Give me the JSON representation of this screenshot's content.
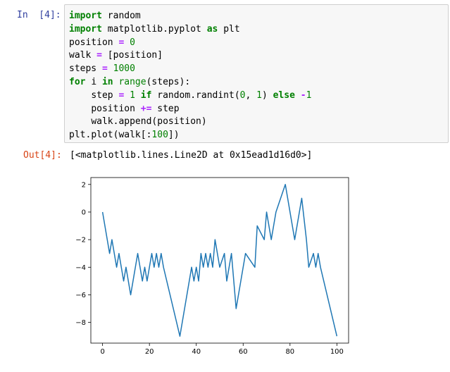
{
  "cell": {
    "in_prompt": "In  [4]:",
    "out_prompt": "Out[4]:",
    "output_text": "[<matplotlib.lines.Line2D at 0x15ead1d16d0>]",
    "code_lines": [
      "import random",
      "import matplotlib.pyplot as plt",
      "position = 0",
      "walk = [position]",
      "steps = 1000",
      "for i in range(steps):",
      "    step = 1 if random.randint(0, 1) else -1",
      "    position += step",
      "    walk.append(position)",
      "plt.plot(walk[:100])"
    ]
  },
  "chart_data": {
    "type": "line",
    "title": "",
    "xlabel": "",
    "ylabel": "",
    "xlim": [
      -5,
      105
    ],
    "ylim": [
      -9.5,
      2.5
    ],
    "xticks": [
      0,
      20,
      40,
      60,
      80,
      100
    ],
    "yticks": [
      2,
      0,
      -2,
      -4,
      -6,
      -8
    ],
    "xtick_labels": [
      "0",
      "20",
      "40",
      "60",
      "80",
      "100"
    ],
    "ytick_labels": [
      "2",
      "0",
      "−2",
      "−4",
      "−6",
      "−8"
    ],
    "grid": false,
    "line_color": "#1f77b4",
    "series": [
      {
        "x": [
          0,
          3,
          4,
          6,
          7,
          9,
          10,
          12,
          15,
          17,
          18,
          19,
          20,
          21,
          22,
          23,
          24,
          25,
          26,
          33,
          38,
          39,
          40,
          41,
          42,
          43,
          44,
          45,
          46,
          47,
          48,
          50,
          52,
          53,
          55,
          57,
          61,
          65,
          66,
          69,
          70,
          71,
          72,
          74,
          78,
          82,
          85,
          87,
          88,
          90,
          91,
          92,
          93,
          100
        ],
        "y": [
          0,
          -3,
          -2,
          -4,
          -3,
          -5,
          -4,
          -6,
          -3,
          -5,
          -4,
          -5,
          -4,
          -3,
          -4,
          -3,
          -4,
          -3,
          -4,
          -9,
          -4,
          -5,
          -4,
          -5,
          -3,
          -4,
          -3,
          -4,
          -3,
          -4,
          -2,
          -4,
          -3,
          -5,
          -3,
          -7,
          -3,
          -4,
          -1,
          -2,
          0,
          -1,
          -2,
          0,
          2,
          -2,
          1,
          -2,
          -4,
          -3,
          -4,
          -3,
          -4,
          -9
        ]
      }
    ]
  }
}
